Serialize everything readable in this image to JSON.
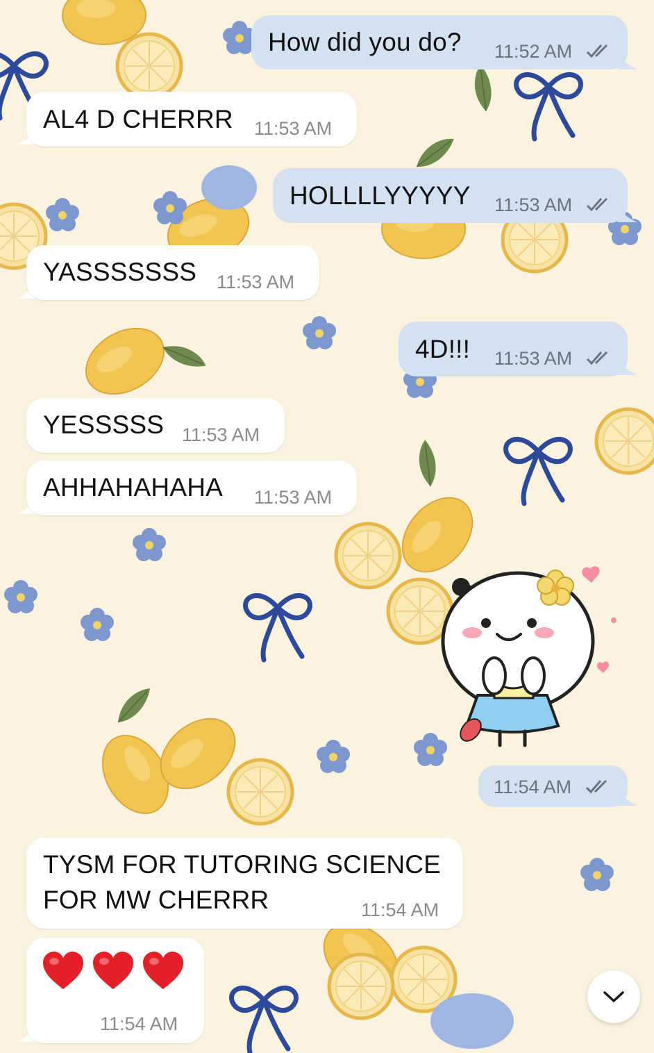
{
  "messages": [
    {
      "id": "m1",
      "dir": "out",
      "text": "How did you do?",
      "time": "11:52 AM",
      "read": true
    },
    {
      "id": "m2",
      "dir": "in",
      "text": "AL4 D CHERRR",
      "time": "11:53 AM"
    },
    {
      "id": "m3",
      "dir": "out",
      "text": "HOLLLLYYYYY",
      "time": "11:53 AM",
      "read": true
    },
    {
      "id": "m4",
      "dir": "in",
      "text": "YASSSSSSS",
      "time": "11:53 AM"
    },
    {
      "id": "m5",
      "dir": "out",
      "text": "4D!!!",
      "time": "11:53 AM",
      "read": true
    },
    {
      "id": "m6",
      "dir": "in",
      "text": "YESSSSS",
      "time": "11:53 AM"
    },
    {
      "id": "m7",
      "dir": "in",
      "text": "AHHAHAHAHA",
      "time": "11:53 AM"
    },
    {
      "id": "m8",
      "dir": "out",
      "sticker": "smiling-mochi-girl-sticker",
      "time": "11:54 AM",
      "read": true
    },
    {
      "id": "m9",
      "dir": "in",
      "lines": [
        "TYSM FOR TUTORING SCIENCE",
        "FOR MW CHERRR"
      ],
      "time": "11:54 AM"
    },
    {
      "id": "m10",
      "dir": "in",
      "emoji": [
        "red-heart",
        "red-heart",
        "red-heart"
      ],
      "time": "11:54 AM"
    }
  ],
  "icons": {
    "read_receipt": "double-check-icon",
    "scroll_down": "chevron-down-icon"
  },
  "colors": {
    "outgoing_bubble": "#d4e1f0",
    "incoming_bubble": "#ffffff",
    "wallpaper": "#fbf3df",
    "heart": "#e3202a"
  }
}
